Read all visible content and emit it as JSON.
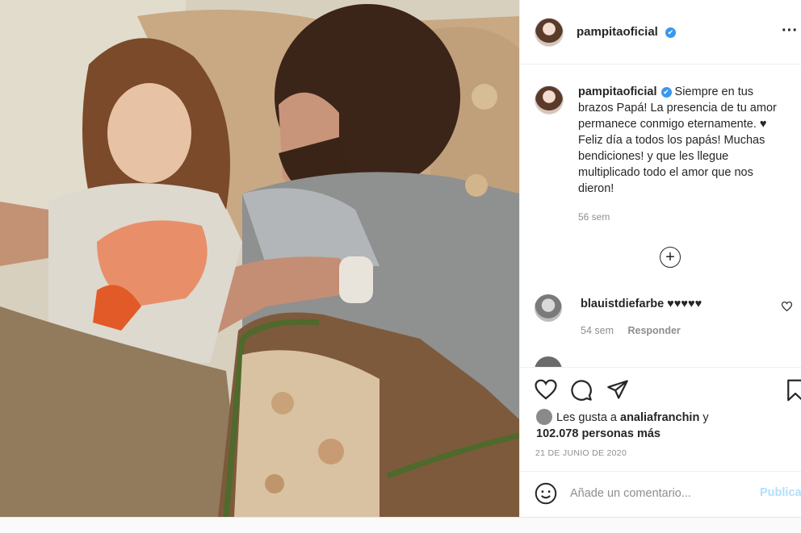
{
  "post": {
    "username": "pampitaoficial",
    "verified_mark": "✔",
    "more_icon": "more-dots-icon",
    "more_glyph": "···"
  },
  "caption": {
    "username": "pampitaoficial",
    "text": " Siempre en tus brazos Papá! La presencia de tu amor permanece conmigo eternamente. ♥ Feliz día a todos los papás! Muchas bendiciones! y que les llegue multiplicado todo el amor que nos dieron!",
    "time": "56 sem"
  },
  "load_more": {
    "glyph": "+",
    "icon": "plus-circle-icon"
  },
  "comments": [
    {
      "username": "blauistdiefarbe",
      "text": " ♥♥♥♥♥",
      "time": "54 sem",
      "reply_label": "Responder"
    }
  ],
  "actions": {
    "like_icon": "heart-icon",
    "comment_icon": "comment-icon",
    "share_icon": "share-icon",
    "save_icon": "bookmark-icon"
  },
  "likes": {
    "prefix": "Les gusta a ",
    "liked_by": "analiafranchin",
    "joiner": " y",
    "count_text": "102.078 personas más"
  },
  "date": "21 DE JUNIO DE 2020",
  "add_comment": {
    "placeholder": "Añade un comentario...",
    "publish_label": "Publicar",
    "emoji_icon": "smiley-icon"
  },
  "colors": {
    "verified": "#3897f0",
    "publish_disabled": "#b2dffc",
    "secondary_text": "#8e8e8e"
  }
}
